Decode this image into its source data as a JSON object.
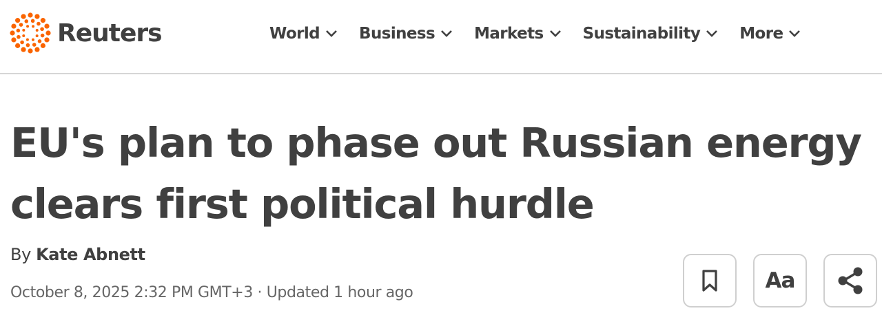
{
  "brand": {
    "name": "Reuters",
    "logo_icon": "reuters-dot-ring-logo",
    "accent_color": "#fa6400"
  },
  "nav": {
    "items": [
      {
        "label": "World",
        "icon": "chevron-down-icon"
      },
      {
        "label": "Business",
        "icon": "chevron-down-icon"
      },
      {
        "label": "Markets",
        "icon": "chevron-down-icon"
      },
      {
        "label": "Sustainability",
        "icon": "chevron-down-icon"
      },
      {
        "label": "More",
        "icon": "chevron-down-icon"
      }
    ]
  },
  "article": {
    "headline": "EU's plan to phase out Russian energy clears first political hurdle",
    "byline_prefix": "By",
    "author": "Kate Abnett",
    "published": "October 8, 2025 2:32 PM GMT+3",
    "separator": "·",
    "updated": "Updated 1 hour ago"
  },
  "tools": {
    "bookmark_icon": "bookmark-icon",
    "text_size_label": "Aa",
    "share_icon": "share-icon"
  },
  "colors": {
    "text": "#404040",
    "muted": "#666666",
    "border": "#cfcfcf"
  }
}
